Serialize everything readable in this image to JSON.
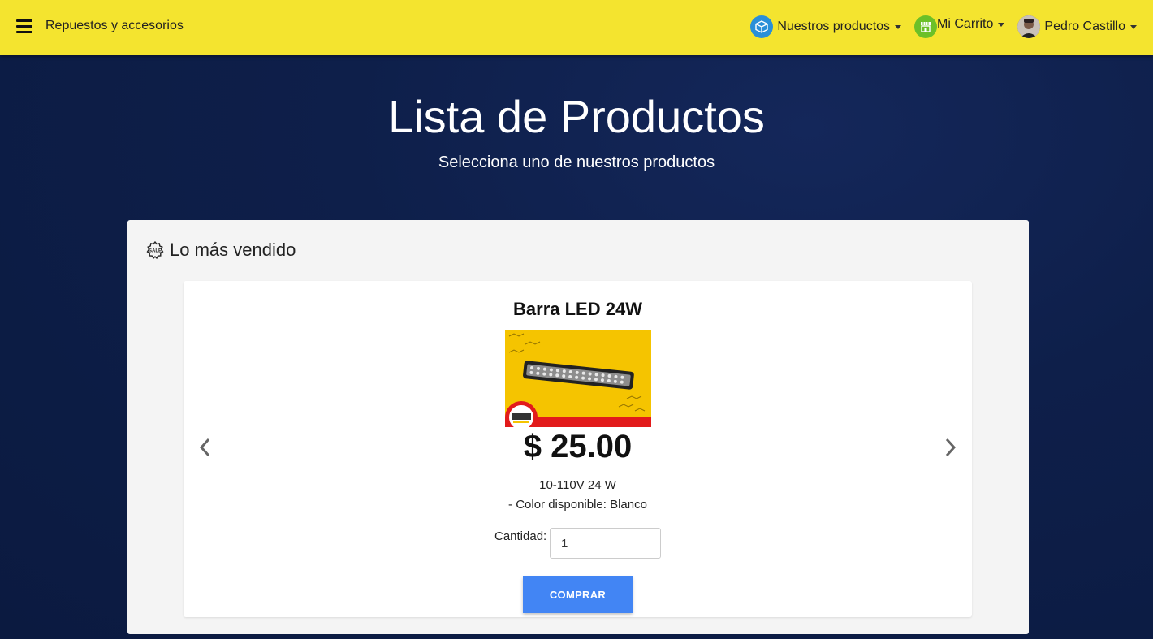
{
  "navbar": {
    "brand": "Repuestos y accesorios",
    "products_label": "Nuestros productos",
    "cart_label": "Mi Carrito",
    "user_label": "Pedro Castillo"
  },
  "hero": {
    "title": "Lista de Productos",
    "subtitle": "Selecciona uno de nuestros productos"
  },
  "section": {
    "title": "Lo más vendido",
    "sale_badge": "SALE"
  },
  "product": {
    "name": "Barra LED 24W",
    "price": "$ 25.00",
    "spec": "10-110V 24 W",
    "color": "- Color disponible: Blanco",
    "quantity_label": "Cantidad:",
    "quantity_value": "1",
    "buy_label": "COMPRAR"
  },
  "colors": {
    "navbar": "#f4e42f",
    "background": "#0e1f4a",
    "button": "#4285f4"
  }
}
